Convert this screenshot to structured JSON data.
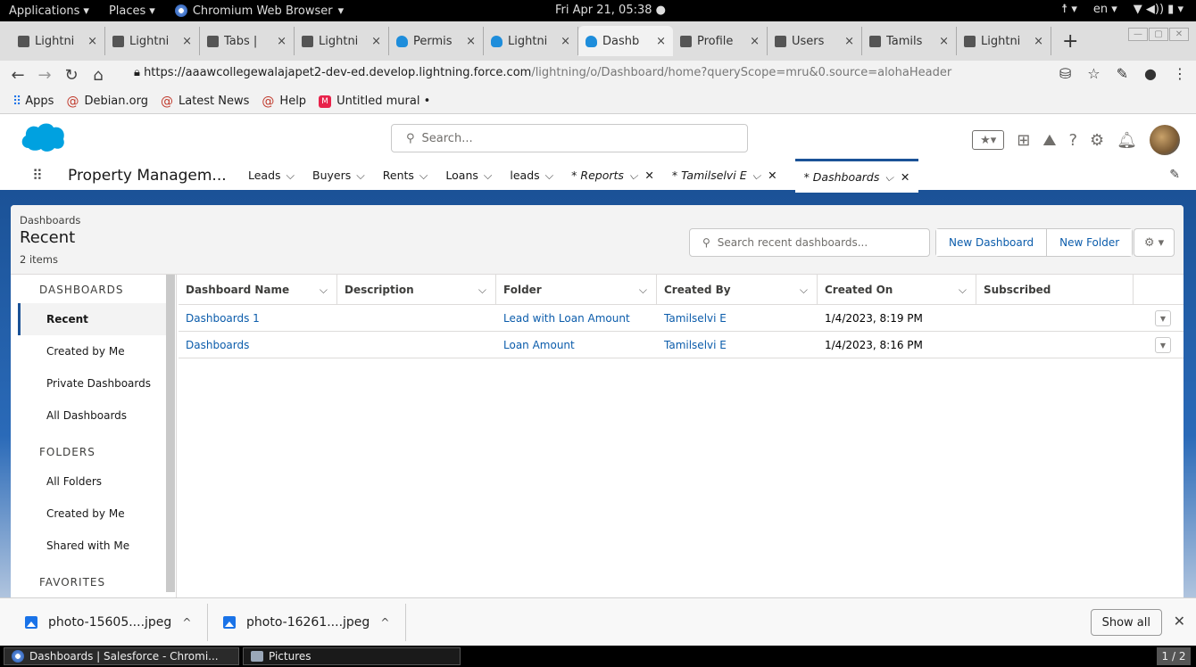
{
  "system_bar": {
    "applications": "Applications",
    "places": "Places",
    "browser": "Chromium Web Browser",
    "clock": "Fri Apr 21, 05:38",
    "language": "en"
  },
  "tabs": [
    {
      "label": "Lightni",
      "icon": "doc-icon",
      "active": false
    },
    {
      "label": "Lightni",
      "icon": "doc-icon",
      "active": false
    },
    {
      "label": "Tabs |",
      "icon": "doc-icon",
      "active": false
    },
    {
      "label": "Lightni",
      "icon": "doc-icon",
      "active": false
    },
    {
      "label": "Permis",
      "icon": "salesforce-icon",
      "active": false
    },
    {
      "label": "Lightni",
      "icon": "salesforce-icon",
      "active": false
    },
    {
      "label": "Dashb",
      "icon": "salesforce-icon",
      "active": true
    },
    {
      "label": "Profile",
      "icon": "doc-icon",
      "active": false
    },
    {
      "label": "Users",
      "icon": "doc-icon",
      "active": false
    },
    {
      "label": "Tamils",
      "icon": "doc-icon",
      "active": false
    },
    {
      "label": "Lightni",
      "icon": "doc-icon",
      "active": false
    }
  ],
  "address": {
    "host": "https://aaawcollegewalajapet2-dev-ed.develop.lightning.force.com",
    "path": "/lightning/o/Dashboard/home?queryScope=mru&0.source=alohaHeader"
  },
  "bookmarks": [
    {
      "label": "Apps",
      "icon": "apps-grid-icon"
    },
    {
      "label": "Debian.org",
      "icon": "debian-icon"
    },
    {
      "label": "Latest News",
      "icon": "debian-icon"
    },
    {
      "label": "Help",
      "icon": "debian-icon"
    },
    {
      "label": "Untitled mural •",
      "icon": "mural-icon"
    }
  ],
  "sf_header": {
    "search_placeholder": "Search..."
  },
  "nav": {
    "app_name": "Property Managem...",
    "items": [
      {
        "label": "Leads"
      },
      {
        "label": "Buyers"
      },
      {
        "label": "Rents"
      },
      {
        "label": "Loans"
      },
      {
        "label": "leads"
      }
    ],
    "tabs": [
      {
        "label": "* Reports"
      },
      {
        "label": "* Tamilselvi E"
      },
      {
        "label": "* Dashboards"
      }
    ]
  },
  "list": {
    "breadcrumb": "Dashboards",
    "title": "Recent",
    "count": "2 items",
    "search_placeholder": "Search recent dashboards...",
    "new_dashboard": "New Dashboard",
    "new_folder": "New Folder"
  },
  "sidebar": {
    "section_dashboards": "DASHBOARDS",
    "items_dashboards": [
      "Recent",
      "Created by Me",
      "Private Dashboards",
      "All Dashboards"
    ],
    "section_folders": "FOLDERS",
    "items_folders": [
      "All Folders",
      "Created by Me",
      "Shared with Me"
    ],
    "section_favorites": "FAVORITES"
  },
  "table": {
    "columns": [
      "Dashboard Name",
      "Description",
      "Folder",
      "Created By",
      "Created On",
      "Subscribed"
    ],
    "rows": [
      {
        "name": "Dashboards 1",
        "description": "",
        "folder": "Lead with Loan Amount",
        "created_by": "Tamilselvi E",
        "created_on": "1/4/2023, 8:19 PM",
        "subscribed": ""
      },
      {
        "name": "Dashboards",
        "description": "",
        "folder": "Loan Amount",
        "created_by": "Tamilselvi E",
        "created_on": "1/4/2023, 8:16 PM",
        "subscribed": ""
      }
    ]
  },
  "downloads": {
    "items": [
      "photo-15605....jpeg",
      "photo-16261....jpeg"
    ],
    "show_all": "Show all"
  },
  "taskbar": {
    "items": [
      "Dashboards | Salesforce - Chromi...",
      "Pictures"
    ],
    "pager": "1 / 2"
  },
  "colors": {
    "brand_blue": "#1b5297",
    "link": "#0b5cab",
    "salesforce_cloud": "#00a1e0"
  }
}
